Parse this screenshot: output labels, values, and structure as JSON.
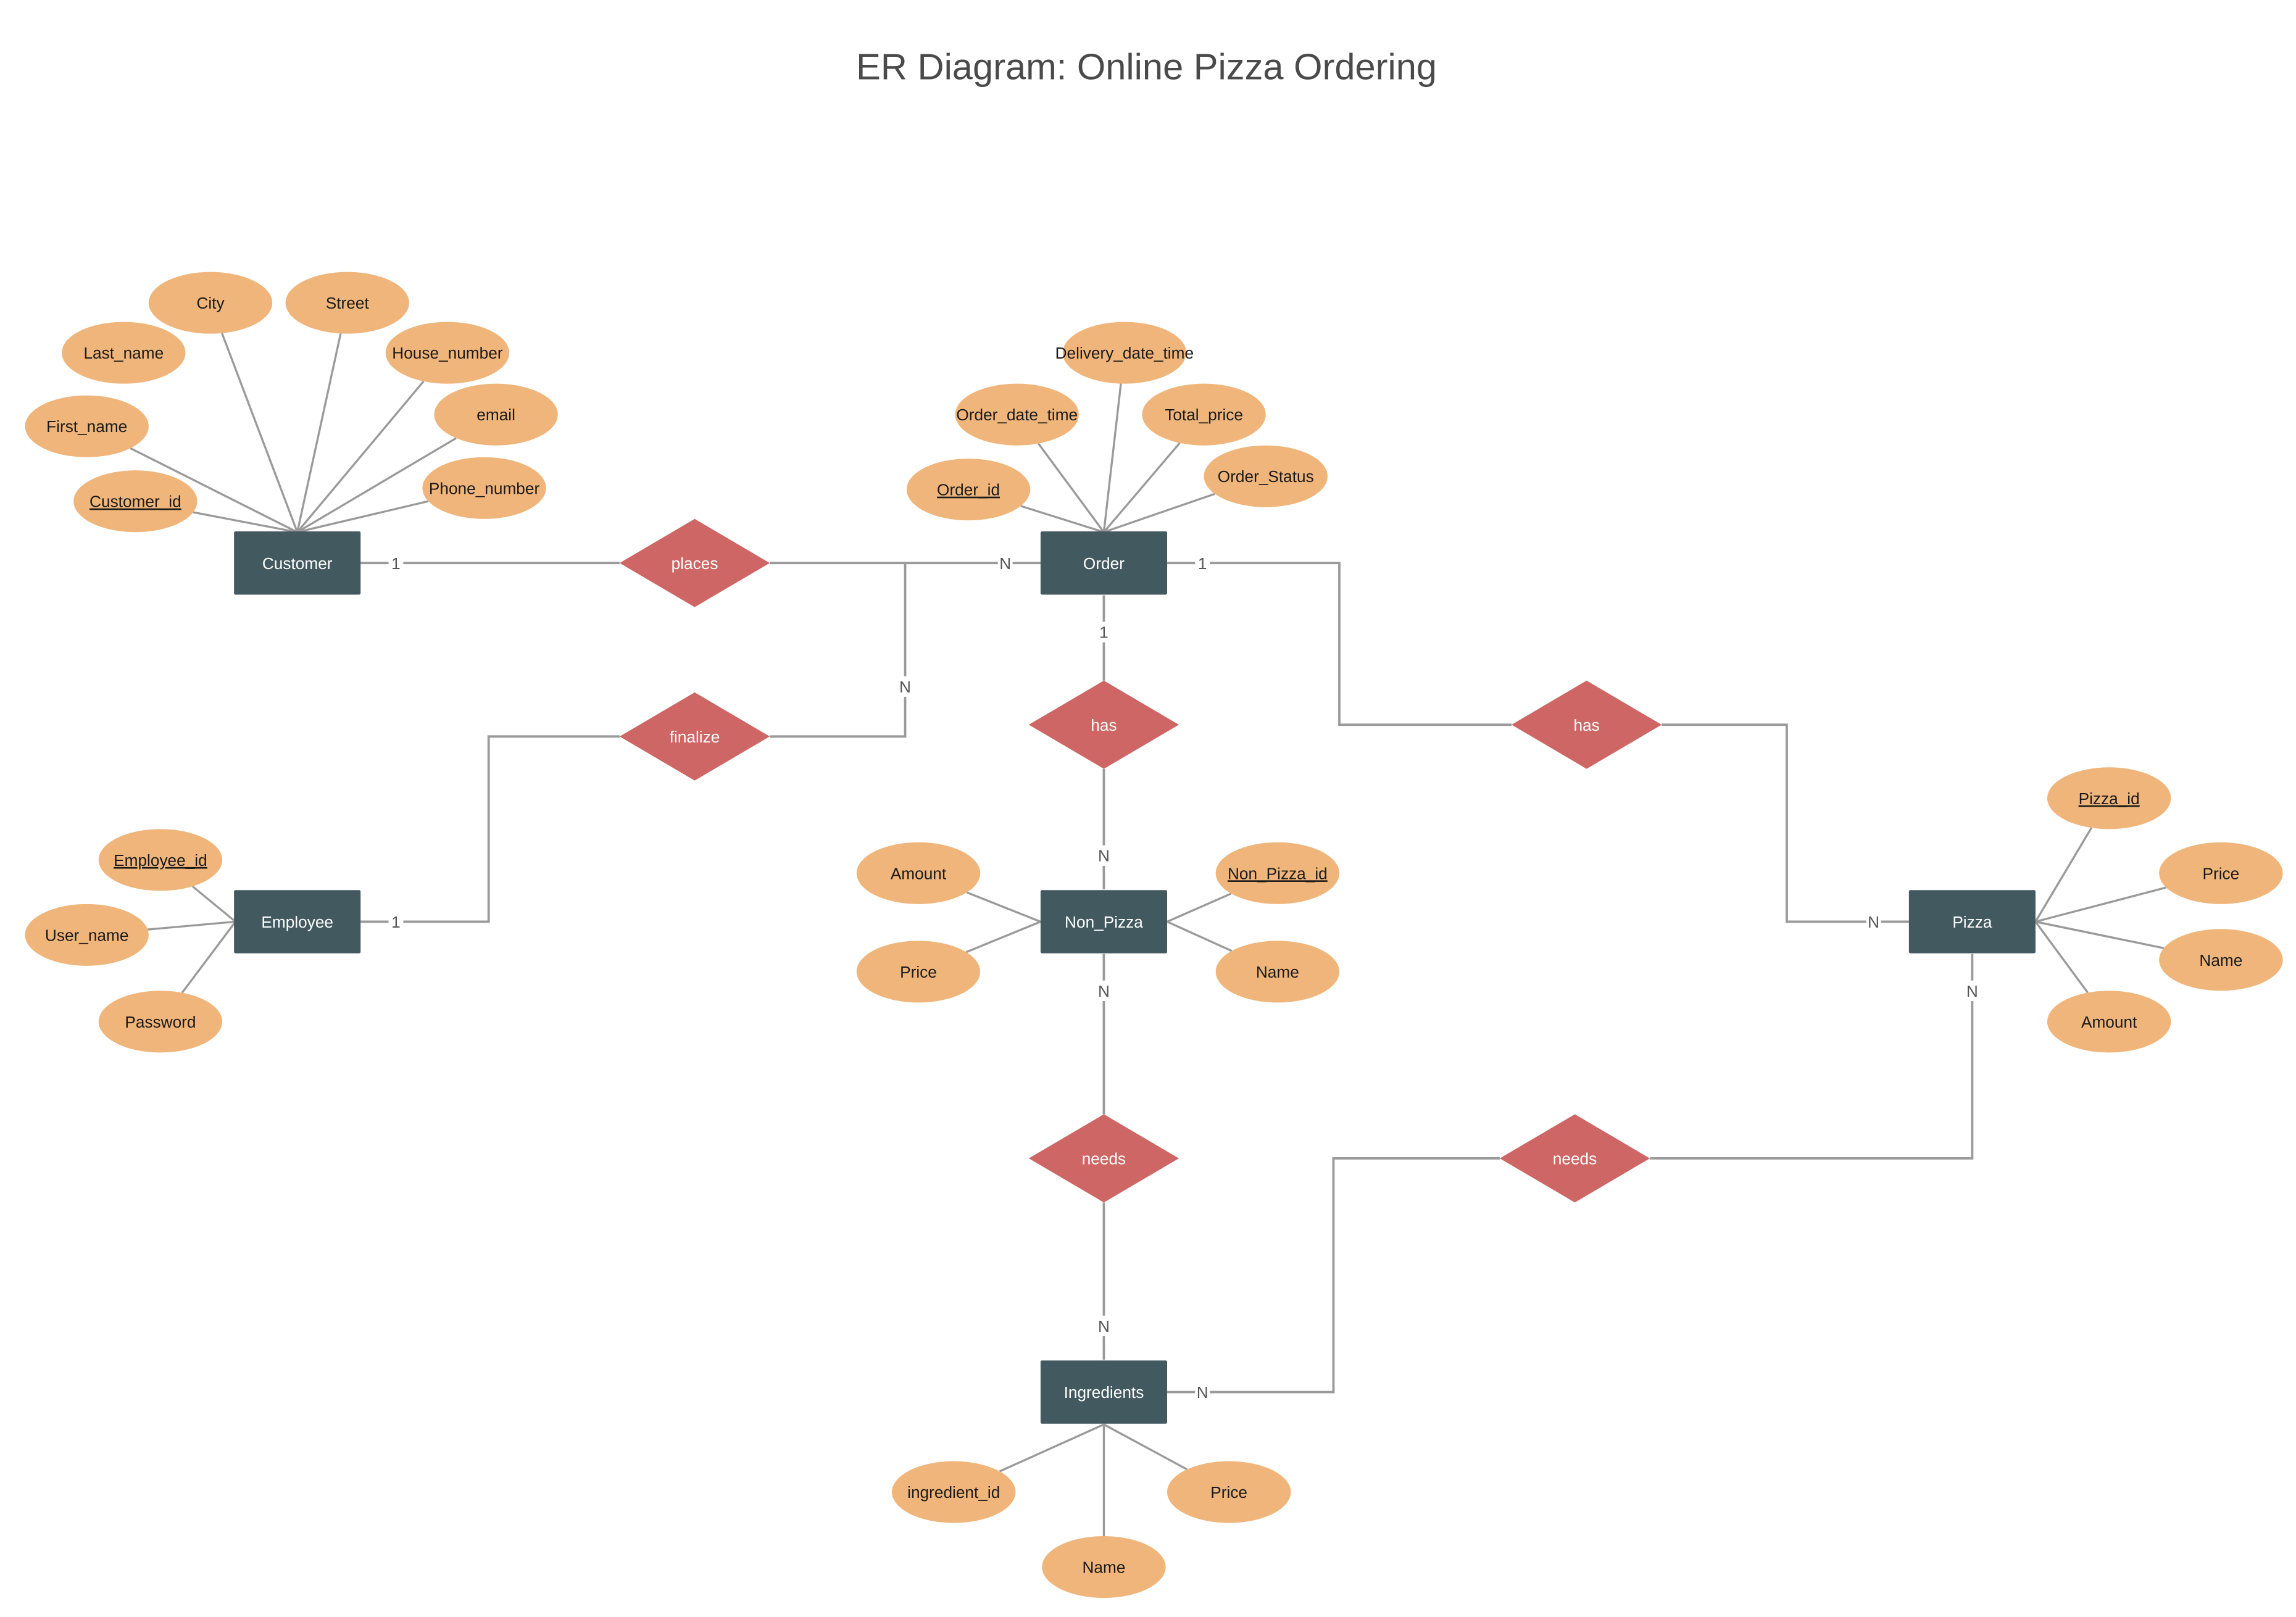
{
  "title": "ER Diagram: Online Pizza Ordering",
  "colors": {
    "entity": "#42595f",
    "relationship": "#cd6664",
    "attribute": "#f0b57a",
    "connector": "#9a9a9a",
    "title": "#4a4a4a"
  },
  "entities": [
    {
      "id": "customer",
      "label": "Customer"
    },
    {
      "id": "order",
      "label": "Order"
    },
    {
      "id": "employee",
      "label": "Employee"
    },
    {
      "id": "non_pizza",
      "label": "Non_Pizza"
    },
    {
      "id": "pizza",
      "label": "Pizza"
    },
    {
      "id": "ingredients",
      "label": "Ingredients"
    }
  ],
  "relationships": [
    {
      "id": "places",
      "label": "places"
    },
    {
      "id": "finalize",
      "label": "finalize"
    },
    {
      "id": "has_nonpizza",
      "label": "has"
    },
    {
      "id": "has_pizza",
      "label": "has"
    },
    {
      "id": "needs_nonpizza",
      "label": "needs"
    },
    {
      "id": "needs_pizza",
      "label": "needs"
    }
  ],
  "attributes": [
    {
      "entity": "customer",
      "label": "City",
      "key": false
    },
    {
      "entity": "customer",
      "label": "Street",
      "key": false
    },
    {
      "entity": "customer",
      "label": "Last_name",
      "key": false
    },
    {
      "entity": "customer",
      "label": "House_number",
      "key": false
    },
    {
      "entity": "customer",
      "label": "First_name",
      "key": false
    },
    {
      "entity": "customer",
      "label": "email",
      "key": false
    },
    {
      "entity": "customer",
      "label": "Customer_id",
      "key": true
    },
    {
      "entity": "customer",
      "label": "Phone_number",
      "key": false
    },
    {
      "entity": "order",
      "label": "Delivery_date_time",
      "key": false
    },
    {
      "entity": "order",
      "label": "Order_date_time",
      "key": false
    },
    {
      "entity": "order",
      "label": "Total_price",
      "key": false
    },
    {
      "entity": "order",
      "label": "Order_id",
      "key": true
    },
    {
      "entity": "order",
      "label": "Order_Status",
      "key": false
    },
    {
      "entity": "employee",
      "label": "Employee_id",
      "key": true
    },
    {
      "entity": "employee",
      "label": "User_name",
      "key": false
    },
    {
      "entity": "employee",
      "label": "Password",
      "key": false
    },
    {
      "entity": "non_pizza",
      "label": "Amount",
      "key": false
    },
    {
      "entity": "non_pizza",
      "label": "Price",
      "key": false
    },
    {
      "entity": "non_pizza",
      "label": "Non_Pizza_id",
      "key": true
    },
    {
      "entity": "non_pizza",
      "label": "Name",
      "key": false
    },
    {
      "entity": "pizza",
      "label": "Pizza_id",
      "key": true
    },
    {
      "entity": "pizza",
      "label": "Price",
      "key": false
    },
    {
      "entity": "pizza",
      "label": "Name",
      "key": false
    },
    {
      "entity": "pizza",
      "label": "Amount",
      "key": false
    },
    {
      "entity": "ingredients",
      "label": "ingredient_id",
      "key": false
    },
    {
      "entity": "ingredients",
      "label": "Price",
      "key": false
    },
    {
      "entity": "ingredients",
      "label": "Name",
      "key": false
    }
  ],
  "connections": [
    {
      "relationship": "places",
      "from": "customer",
      "from_card": "1",
      "to": "order",
      "to_card": "N"
    },
    {
      "relationship": "finalize",
      "from": "employee",
      "from_card": "1",
      "to": "order",
      "to_card": "N"
    },
    {
      "relationship": "has_nonpizza",
      "from": "order",
      "from_card": "1",
      "to": "non_pizza",
      "to_card": "N"
    },
    {
      "relationship": "has_pizza",
      "from": "order",
      "from_card": "1",
      "to": "pizza",
      "to_card": "N"
    },
    {
      "relationship": "needs_nonpizza",
      "from": "non_pizza",
      "from_card": "N",
      "to": "ingredients",
      "to_card": "N"
    },
    {
      "relationship": "needs_pizza",
      "from": "pizza",
      "from_card": "N",
      "to": "ingredients",
      "to_card": "N"
    }
  ]
}
